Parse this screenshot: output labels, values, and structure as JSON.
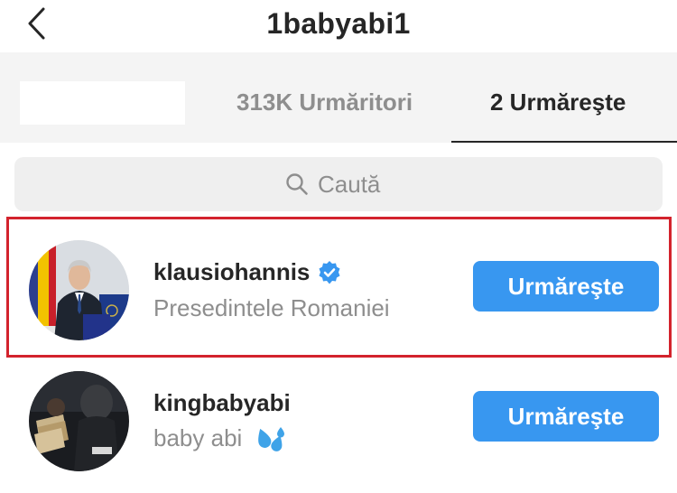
{
  "header": {
    "title": "1babyabi1",
    "back_icon": "chevron-left-icon"
  },
  "tabs": {
    "followers_label": "313K Urmăritori",
    "following_label": "2 Urmăreşte",
    "active": "following"
  },
  "search": {
    "placeholder": "Caută",
    "icon": "search-icon"
  },
  "list": [
    {
      "username": "klausiohannis",
      "verified": true,
      "subtitle": "Presedintele Romaniei",
      "button_label": "Urmăreşte",
      "highlighted": true
    },
    {
      "username": "kingbabyabi",
      "verified": false,
      "subtitle": "baby abi",
      "subtitle_emoji": "droplets-icon",
      "button_label": "Urmăreşte",
      "highlighted": false
    }
  ],
  "colors": {
    "accent": "#3897f0",
    "highlight_border": "#d3232d",
    "tab_background": "#f4f4f4",
    "search_background": "#efefef",
    "muted_text": "#8e8e8e",
    "primary_text": "#262626"
  }
}
